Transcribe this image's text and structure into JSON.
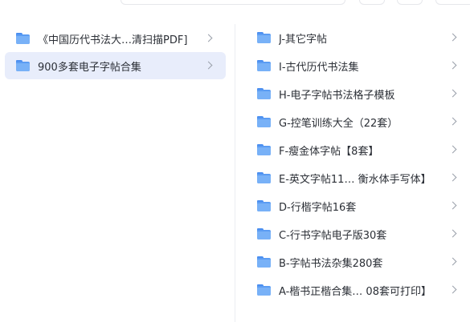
{
  "left_column": {
    "items": [
      {
        "label": "《中国历代书法大…清扫描PDF]",
        "selected": false
      },
      {
        "label": "900多套电子字帖合集",
        "selected": true
      }
    ]
  },
  "right_column": {
    "items": [
      {
        "label": "J-其它字帖"
      },
      {
        "label": "I-古代历代书法集"
      },
      {
        "label": "H-电子字帖书法格子模板"
      },
      {
        "label": "G-控笔训练大全（22套）"
      },
      {
        "label": "F-瘦金体字帖【8套】"
      },
      {
        "label": "E-英文字帖11… 衡水体手写体】"
      },
      {
        "label": "D-行楷字帖16套"
      },
      {
        "label": "C-行书字帖电子版30套"
      },
      {
        "label": "B-字帖书法杂集280套"
      },
      {
        "label": "A-楷书正楷合集… 08套可打印】"
      }
    ]
  },
  "colors": {
    "selected_bg": "#e8edfb",
    "folder_blue": "#5b9cf3",
    "text": "#2b2f36"
  },
  "icons": {
    "folder": "folder-icon",
    "chevron": "chevron-right-icon"
  }
}
